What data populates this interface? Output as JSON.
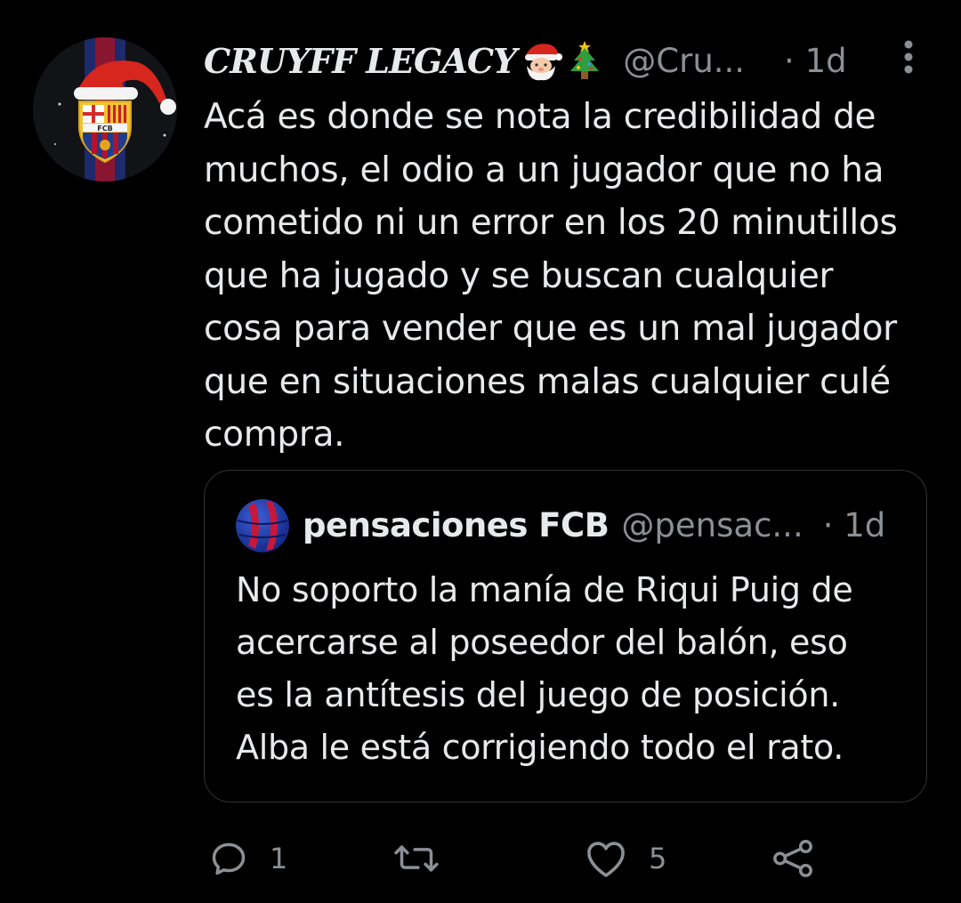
{
  "tweet": {
    "display_name": "CRUYFF LEGACY",
    "name_emojis": [
      "santa-emoji",
      "christmas-tree-emoji"
    ],
    "handle": "@Cru...",
    "time": "· 1d",
    "text": "Acá es donde se nota la credibilidad de muchos, el odio a un jugador que no ha cometido ni un error en los 20 minutillos que ha jugado y se buscan cualquier cosa para vender que es un mal jugador que en situaciones malas cualquier culé compra.",
    "text_lines": [
      "Acá es donde se nota la credibilidad de",
      "muchos, el odio a un jugador que no ha",
      "cometido ni un error en los 20 minutillos",
      "que ha jugado y se buscan cualquier",
      "cosa para vender que es un mal jugador",
      "que en situaciones malas cualquier culé",
      "compra."
    ],
    "avatar": "fcb-crest-santa-hat-avatar",
    "more_icon": "more-vertical-icon"
  },
  "quoted": {
    "display_name": "pensaciones FCB",
    "handle": "@pensac...",
    "time": "· 1d",
    "avatar": "blaugrana-ball-avatar",
    "text_lines": [
      "No soporto la manía de Riqui Puig de",
      "acercarse al poseedor del balón, eso",
      "es la antítesis del juego de posición.",
      "Alba le está corrigiendo todo el rato."
    ]
  },
  "actions": {
    "reply": {
      "icon": "reply-icon",
      "count": "1"
    },
    "retweet": {
      "icon": "retweet-icon",
      "count": ""
    },
    "like": {
      "icon": "heart-icon",
      "count": "5"
    },
    "share": {
      "icon": "share-icon"
    }
  },
  "colors": {
    "background": "#000000",
    "text": "#e7e9ea",
    "secondary": "#8b9095",
    "border": "#2f3336"
  }
}
